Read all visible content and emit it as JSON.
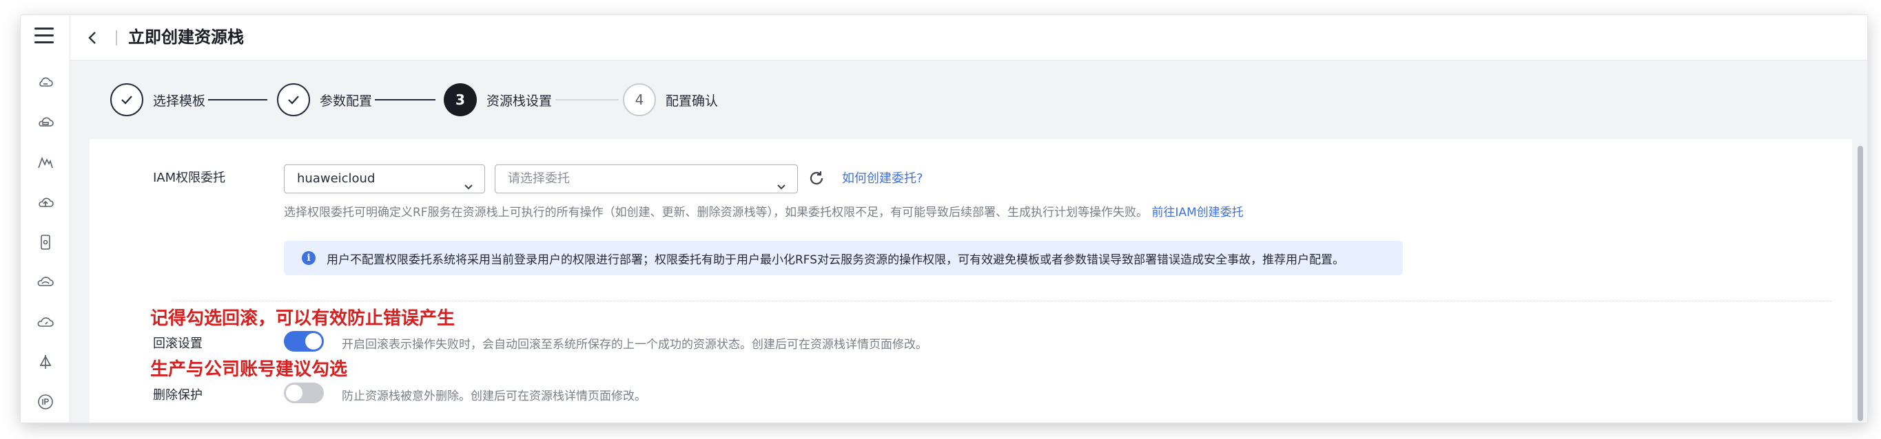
{
  "header": {
    "title": "立即创建资源栈"
  },
  "steps": [
    {
      "number": "1",
      "label": "选择模板",
      "state": "done"
    },
    {
      "number": "2",
      "label": "参数配置",
      "state": "done"
    },
    {
      "number": "3",
      "label": "资源栈设置",
      "state": "active"
    },
    {
      "number": "4",
      "label": "配置确认",
      "state": "todo"
    }
  ],
  "sidebar": {
    "icons": [
      "cloud-icon",
      "cloud-server-icon",
      "mountain-icon",
      "cloud-upload-icon",
      "device-icon",
      "cloud-alt-icon",
      "cloud-gauge-icon",
      "antenna-icon",
      "ip-icon"
    ]
  },
  "iam": {
    "label": "IAM权限委托",
    "provider_value": "huaweicloud",
    "delegate_placeholder": "请选择委托",
    "help_link": "如何创建委托?",
    "description": "选择权限委托可明确定义RF服务在资源栈上可执行的所有操作（如创建、更新、删除资源栈等），如果委托权限不足，有可能导致后续部署、生成执行计划等操作失败。",
    "description_link": "前往IAM创建委托",
    "info": "用户不配置权限委托系统将采用当前登录用户的权限进行部署；权限委托有助于用户最小化RFS对云服务资源的操作权限，可有效避免模板或者参数错误导致部署错误造成安全事故，推荐用户配置。"
  },
  "rollback": {
    "annotation": "记得勾选回滚，可以有效防止错误产生",
    "label": "回滚设置",
    "enabled": true,
    "description": "开启回滚表示操作失败时，会自动回滚至系统所保存的上一个成功的资源状态。创建后可在资源栈详情页面修改。"
  },
  "deletion_protection": {
    "annotation": "生产与公司账号建议勾选",
    "label": "删除保护",
    "enabled": false,
    "description": "防止资源栈被意外删除。创建后可在资源栈详情页面修改。"
  },
  "colors": {
    "accent": "#3d70e0",
    "annotation": "#d61f1f",
    "info_bg": "#e8efff"
  }
}
